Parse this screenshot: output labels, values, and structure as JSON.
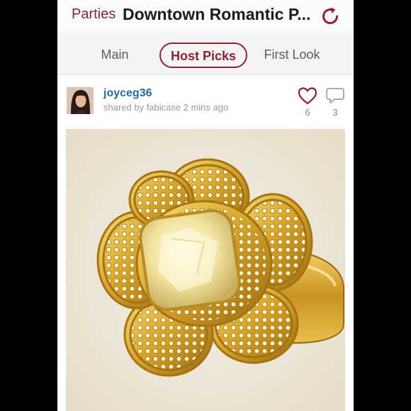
{
  "header": {
    "back_label": "Parties",
    "title": "Downtown Romantic P..."
  },
  "tabs": [
    {
      "label": "Main"
    },
    {
      "label": "Host Picks"
    },
    {
      "label": "First Look"
    }
  ],
  "post": {
    "username": "joyceg36",
    "shared_text": "shared by fabicase 2 mins ago",
    "likes": "6",
    "comments": "3"
  },
  "colors": {
    "accent": "#8a2433",
    "username": "#2a6aa6"
  },
  "icons": {
    "refresh": "refresh-icon",
    "like": "heart-icon",
    "comment": "comment-icon"
  }
}
